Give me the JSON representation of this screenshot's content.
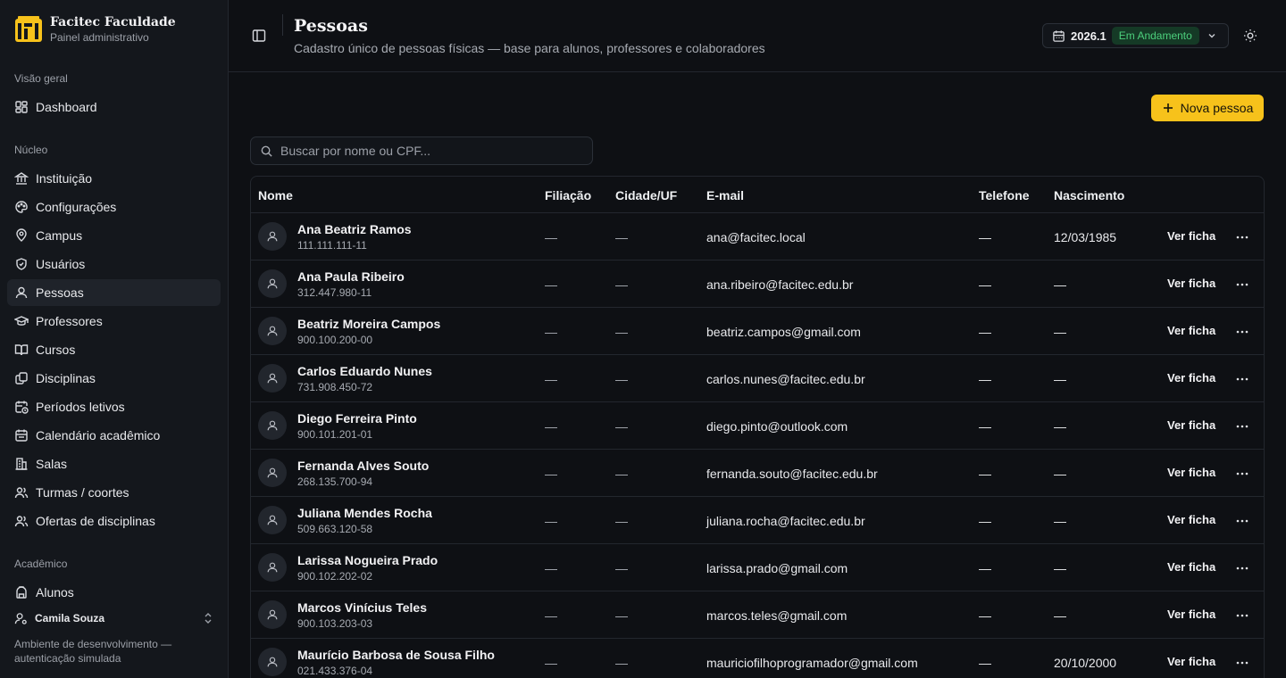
{
  "brand": {
    "title": "Facitec Faculdade",
    "subtitle": "Painel administrativo"
  },
  "sidebar": {
    "sections": [
      {
        "label": "Visão geral"
      },
      {
        "label": "Núcleo"
      },
      {
        "label": "Acadêmico"
      }
    ],
    "items": [
      {
        "label": "Dashboard",
        "icon": "dashboard-icon"
      },
      {
        "label": "Instituição",
        "icon": "landmark-icon"
      },
      {
        "label": "Configurações",
        "icon": "palette-icon"
      },
      {
        "label": "Campus",
        "icon": "map-pin-icon"
      },
      {
        "label": "Usuários",
        "icon": "shield-icon"
      },
      {
        "label": "Pessoas",
        "icon": "user-icon",
        "active": true
      },
      {
        "label": "Professores",
        "icon": "graduation-cap-icon"
      },
      {
        "label": "Cursos",
        "icon": "book-open-icon"
      },
      {
        "label": "Disciplinas",
        "icon": "copy-icon"
      },
      {
        "label": "Períodos letivos",
        "icon": "calendar-clock-icon"
      },
      {
        "label": "Calendário acadêmico",
        "icon": "calendar-icon"
      },
      {
        "label": "Salas",
        "icon": "building-icon"
      },
      {
        "label": "Turmas / coortes",
        "icon": "users-icon"
      },
      {
        "label": "Ofertas de disciplinas",
        "icon": "users-round-icon"
      },
      {
        "label": "Alunos",
        "icon": "backpack-icon"
      }
    ],
    "user": {
      "name": "Camila Souza",
      "icon": "user-cog-icon"
    },
    "env_note": "Ambiente de desenvolvimento — autenticação simulada"
  },
  "header": {
    "title": "Pessoas",
    "subtitle": "Cadastro único de pessoas físicas — base para alunos, professores e colaboradores",
    "period": {
      "value": "2026.1",
      "status": "Em Andamento"
    }
  },
  "actions": {
    "new_label": "Nova pessoa"
  },
  "search": {
    "placeholder": "Buscar por nome ou CPF..."
  },
  "table": {
    "columns": [
      "Nome",
      "Filiação",
      "Cidade/UF",
      "E-mail",
      "Telefone",
      "Nascimento"
    ],
    "action_label": "Ver ficha",
    "rows": [
      {
        "name": "Ana Beatriz Ramos",
        "cpf": "111.111.111-11",
        "filiacao": "—",
        "cidade": "—",
        "email": "ana@facitec.local",
        "telefone": "—",
        "nascimento": "12/03/1985"
      },
      {
        "name": "Ana Paula Ribeiro",
        "cpf": "312.447.980-11",
        "filiacao": "—",
        "cidade": "—",
        "email": "ana.ribeiro@facitec.edu.br",
        "telefone": "—",
        "nascimento": "—"
      },
      {
        "name": "Beatriz Moreira Campos",
        "cpf": "900.100.200-00",
        "filiacao": "—",
        "cidade": "—",
        "email": "beatriz.campos@gmail.com",
        "telefone": "—",
        "nascimento": "—"
      },
      {
        "name": "Carlos Eduardo Nunes",
        "cpf": "731.908.450-72",
        "filiacao": "—",
        "cidade": "—",
        "email": "carlos.nunes@facitec.edu.br",
        "telefone": "—",
        "nascimento": "—"
      },
      {
        "name": "Diego Ferreira Pinto",
        "cpf": "900.101.201-01",
        "filiacao": "—",
        "cidade": "—",
        "email": "diego.pinto@outlook.com",
        "telefone": "—",
        "nascimento": "—"
      },
      {
        "name": "Fernanda Alves Souto",
        "cpf": "268.135.700-94",
        "filiacao": "—",
        "cidade": "—",
        "email": "fernanda.souto@facitec.edu.br",
        "telefone": "—",
        "nascimento": "—"
      },
      {
        "name": "Juliana Mendes Rocha",
        "cpf": "509.663.120-58",
        "filiacao": "—",
        "cidade": "—",
        "email": "juliana.rocha@facitec.edu.br",
        "telefone": "—",
        "nascimento": "—"
      },
      {
        "name": "Larissa Nogueira Prado",
        "cpf": "900.102.202-02",
        "filiacao": "—",
        "cidade": "—",
        "email": "larissa.prado@gmail.com",
        "telefone": "—",
        "nascimento": "—"
      },
      {
        "name": "Marcos Vinícius Teles",
        "cpf": "900.103.203-03",
        "filiacao": "—",
        "cidade": "—",
        "email": "marcos.teles@gmail.com",
        "telefone": "—",
        "nascimento": "—"
      },
      {
        "name": "Maurício Barbosa de Sousa Filho",
        "cpf": "021.433.376-04",
        "filiacao": "—",
        "cidade": "—",
        "email": "mauriciofilhoprogramador@gmail.com",
        "telefone": "—",
        "nascimento": "20/10/2000"
      }
    ]
  }
}
